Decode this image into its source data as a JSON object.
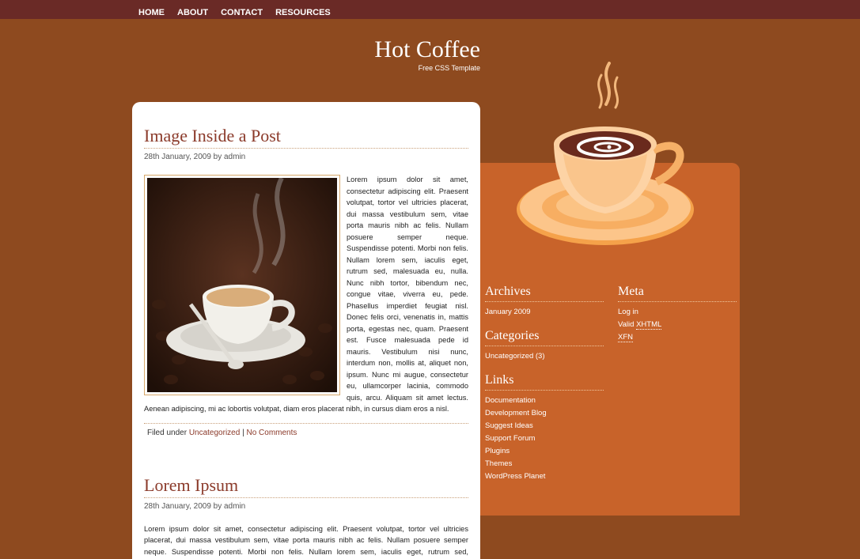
{
  "nav": {
    "items": [
      "HOME",
      "ABOUT",
      "CONTACT",
      "RESOURCES"
    ]
  },
  "header": {
    "title": "Hot Coffee",
    "tagline": "Free CSS Template"
  },
  "posts": [
    {
      "title": "Image Inside a Post",
      "meta": "28th January, 2009 by admin",
      "body": "Lorem ipsum dolor sit amet, consectetur adipiscing elit. Praesent volutpat, tortor vel ultricies placerat, dui massa vestibulum sem, vitae porta mauris nibh ac felis. Nullam posuere semper neque. Suspendisse potenti. Morbi non felis. Nullam lorem sem, iaculis eget, rutrum sed, malesuada eu, nulla. Nunc nibh tortor, bibendum nec, congue vitae, viverra eu, pede. Phasellus imperdiet feugiat nisl. Donec felis orci, venenatis in, mattis porta, egestas nec, quam. Praesent est. Fusce malesuada pede id mauris. Vestibulum nisi nunc, interdum non, mollis at, aliquet non, ipsum. Nunc mi augue, consectetur eu, ullamcorper lacinia, commodo quis, arcu. Aliquam sit amet lectus. Aenean adipiscing, mi ac lobortis volutpat, diam eros placerat nibh, in cursus diam eros a nisl.",
      "footer_prefix": "Filed under",
      "category": "Uncategorized",
      "separator": "|",
      "comments": "No Comments"
    },
    {
      "title": "Lorem Ipsum",
      "meta": "28th January, 2009 by admin",
      "body": "Lorem ipsum dolor sit amet, consectetur adipiscing elit. Praesent volutpat, tortor vel ultricies placerat, dui massa vestibulum sem, vitae porta mauris nibh ac felis. Nullam posuere semper neque. Suspendisse potenti. Morbi non felis. Nullam lorem sem, iaculis eget, rutrum sed, malesuada eu, nulla. Nunc nibh tortor, bibendum nec, congue vitae, viverra eu, pede. Phasellus"
    }
  ],
  "sidebar": {
    "archives": {
      "title": "Archives",
      "items": [
        "January 2009"
      ]
    },
    "categories": {
      "title": "Categories",
      "items": [
        "Uncategorized (3)"
      ]
    },
    "links": {
      "title": "Links",
      "items": [
        "Documentation",
        "Development Blog",
        "Suggest Ideas",
        "Support Forum",
        "Plugins",
        "Themes",
        "WordPress Planet"
      ]
    },
    "meta": {
      "title": "Meta",
      "login": "Log in",
      "valid": "Valid",
      "xhtml": "XHTML",
      "xfn": "XFN"
    }
  },
  "colors": {
    "background": "#8e4a1f",
    "nav_bar": "#6a2a26",
    "sidebar": "#c8632a",
    "post_title": "#8b3a2a"
  }
}
